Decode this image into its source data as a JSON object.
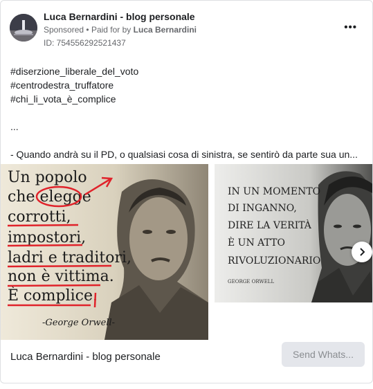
{
  "ad": {
    "page_name": "Luca Bernardini - blog personale",
    "sponsored_label": "Sponsored",
    "separator": "•",
    "paid_for_prefix": "Paid for by",
    "paid_for_name": "Luca Bernardini",
    "id_text": "ID: 754556292521437",
    "more_icon": "more-horizontal-icon"
  },
  "body": {
    "lines": [
      "#diserzione_liberale_del_voto",
      "#centrodestra_truffatore",
      "#chi_li_vota_è_complice",
      "...",
      "- Quando andrà su il PD, o qualsiasi cosa di sinistra, se sentirò da parte sua un..."
    ]
  },
  "carousel": {
    "card1": {
      "lines": [
        "Un popolo",
        "che elegge",
        "corrotti,",
        "impostori,",
        "ladri e traditori,",
        "non è vittima.",
        "È complice."
      ],
      "signature": "-George Orwell-"
    },
    "card2": {
      "lines": [
        "IN UN MOMENTO",
        "DI INGANNO,",
        "DIRE LA VERITÀ",
        "È UN ATTO",
        "RIVOLUZIONARIO"
      ],
      "signature": "GEORGE ORWELL"
    },
    "next_icon": "chevron-right-icon"
  },
  "footer": {
    "title": "Luca Bernardini - blog personale",
    "cta_label": "Send Whats..."
  },
  "colors": {
    "annotation_red": "#e0222a",
    "secondary_text": "#65676b",
    "cta_bg": "#e4e6eb"
  }
}
